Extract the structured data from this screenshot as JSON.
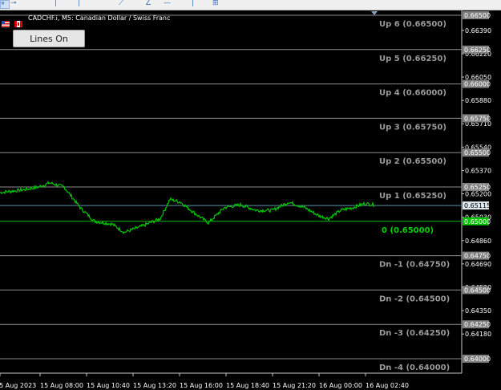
{
  "toolbar": {
    "icons": [
      "crosshair-icon",
      "connector-icon",
      "vertical-line-icon",
      "vertical-line-icon",
      "trendline-icon",
      "angle-line-icon",
      "horizontal-line-icon",
      "vertical-line-icon",
      "channel-icon"
    ]
  },
  "header": {
    "symbol_title": "CADCHF.i, M5:  Canadian Dollar / Swiss Franc",
    "flag_icons": [
      "flag-icon",
      "flag-icon"
    ]
  },
  "button": {
    "label": "Lines On"
  },
  "colors": {
    "background": "#000000",
    "price_line": "#00c800",
    "level_line": "#8c8c8c",
    "level_text": "#9a9a9a",
    "zero_text": "#00d000",
    "zero_line": "#00c000",
    "current_line": "#5a8fa8",
    "axis_text": "#ffffff",
    "level_box": "#808080"
  },
  "levels": [
    {
      "label": "Up 6 (0.66500)",
      "price": 0.665,
      "badge": "0.66500"
    },
    {
      "label": "Up 5 (0.66250)",
      "price": 0.6625,
      "badge": "0.66250"
    },
    {
      "label": "Up 4 (0.66000)",
      "price": 0.66,
      "badge": "0.66000"
    },
    {
      "label": "Up 3 (0.65750)",
      "price": 0.6575,
      "badge": "0.65750"
    },
    {
      "label": "Up 2 (0.65500)",
      "price": 0.655,
      "badge": "0.65500"
    },
    {
      "label": "Up 1 (0.65250)",
      "price": 0.6525,
      "badge": "0.65250"
    },
    {
      "label": "0 (0.65000)",
      "price": 0.65,
      "badge": "0.65000",
      "zero": true
    },
    {
      "label": "Dn -1 (0.64750)",
      "price": 0.6475,
      "badge": "0.64750"
    },
    {
      "label": "Dn -2 (0.64500)",
      "price": 0.645,
      "badge": "0.64500"
    },
    {
      "label": "Dn -3 (0.64250)",
      "price": 0.6425,
      "badge": "0.64250"
    },
    {
      "label": "Dn -4 (0.64000)",
      "price": 0.64,
      "badge": "0.64000"
    }
  ],
  "current_price": {
    "price": 0.65115,
    "badge": "0.65115"
  },
  "price_axis_ticks": [
    {
      "label": "0.66390",
      "price": 0.6639
    },
    {
      "label": "0.66220",
      "price": 0.6622
    },
    {
      "label": "0.66050",
      "price": 0.6605
    },
    {
      "label": "0.65880",
      "price": 0.6588
    },
    {
      "label": "0.65710",
      "price": 0.6571
    },
    {
      "label": "0.65540",
      "price": 0.6554
    },
    {
      "label": "0.65370",
      "price": 0.6537
    },
    {
      "label": "0.65200",
      "price": 0.652
    },
    {
      "label": "0.65030",
      "price": 0.6503
    },
    {
      "label": "0.64860",
      "price": 0.6486
    },
    {
      "label": "0.64690",
      "price": 0.6469
    },
    {
      "label": "0.64520",
      "price": 0.6452
    },
    {
      "label": "0.64350",
      "price": 0.6435
    },
    {
      "label": "0.64180",
      "price": 0.6418
    }
  ],
  "time_axis": [
    "15 Aug 2023",
    "15 Aug 08:00",
    "15 Aug 10:40",
    "15 Aug 13:20",
    "15 Aug 16:00",
    "15 Aug 18:40",
    "15 Aug 21:20",
    "16 Aug 00:00",
    "16 Aug 02:40"
  ],
  "chart_data": {
    "type": "line",
    "x": [
      "15 Aug 2023",
      "15 Aug 08:00",
      "15 Aug 10:40",
      "15 Aug 13:20",
      "15 Aug 16:00",
      "15 Aug 18:40",
      "15 Aug 21:20",
      "16 Aug 00:00",
      "16 Aug 02:40"
    ],
    "series": [
      {
        "values": [
          0.6522,
          0.6527,
          0.6504,
          0.6497,
          0.6516,
          0.6508,
          0.6513,
          0.6504,
          0.6512
        ]
      }
    ],
    "ylim": [
      0.6398,
      0.6651
    ],
    "grid": false
  }
}
